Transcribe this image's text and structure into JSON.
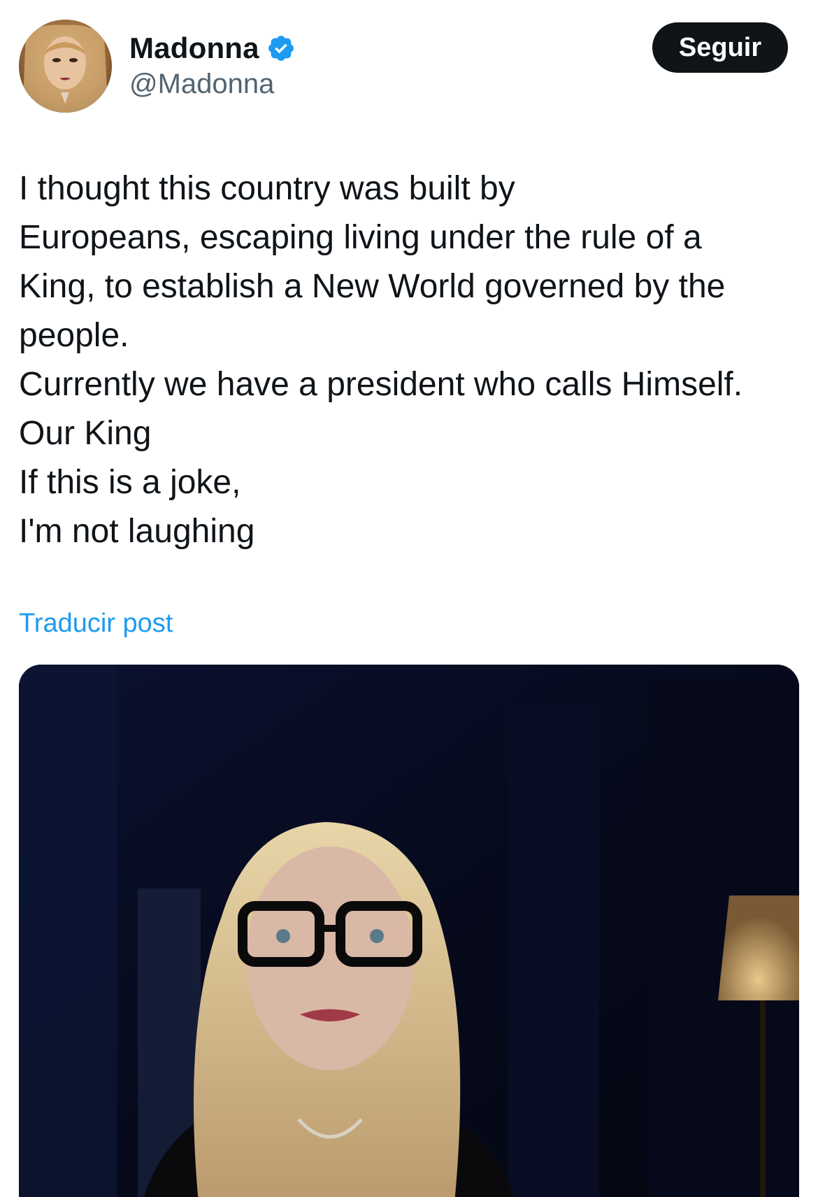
{
  "author": {
    "name": "Madonna",
    "handle": "@Madonna",
    "verified": true,
    "verified_color": "#1d9bf0"
  },
  "follow_button": {
    "label": "Seguir"
  },
  "post": {
    "lines": [
      "I thought this country was built by",
      "Europeans, escaping living under the rule of a",
      "King, to establish a New World governed by the",
      "people.",
      "Currently we have a president who calls Himself.",
      "Our King",
      "If this is a joke,",
      "I'm not laughing"
    ],
    "translate_label": "Traducir post"
  },
  "colors": {
    "text": "#0f1419",
    "secondary": "#536471",
    "link": "#1d9bf0",
    "button_bg": "#0f1419"
  }
}
